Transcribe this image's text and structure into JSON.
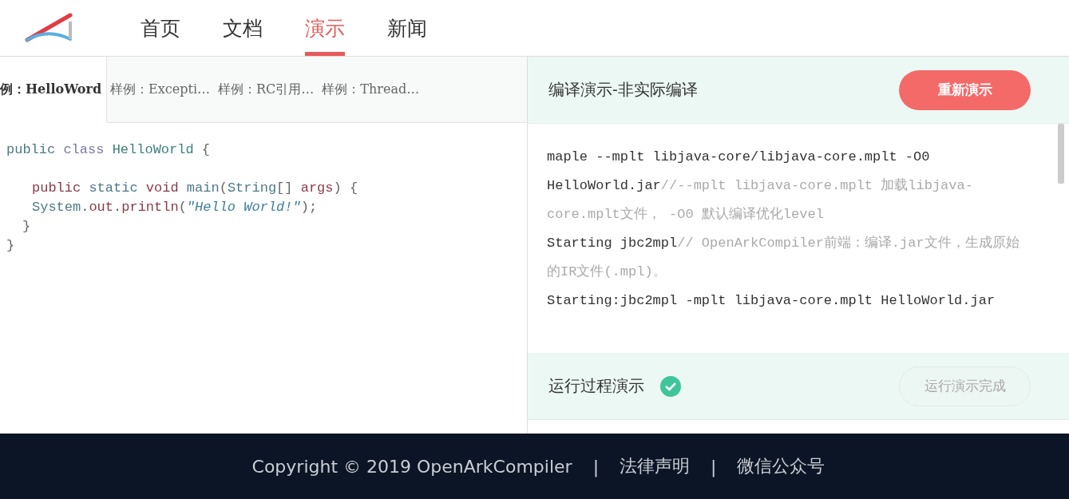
{
  "nav": [
    {
      "label": "首页",
      "selected": false
    },
    {
      "label": "文档",
      "selected": false
    },
    {
      "label": "演示",
      "selected": true
    },
    {
      "label": "新闻",
      "selected": false
    }
  ],
  "sample_tabs": [
    {
      "label": "例：HelloWord",
      "selected": true
    },
    {
      "label": "样例：Excepti…",
      "selected": false
    },
    {
      "label": "样例：RC引用…",
      "selected": false
    },
    {
      "label": "样例：Thread…",
      "selected": false
    }
  ],
  "code_lines": [
    {
      "kind": "class_open",
      "tokens": [
        {
          "kind": "keyword",
          "text": "public "
        },
        {
          "kind": "keyword2",
          "text": "class "
        },
        {
          "kind": "name",
          "text": "HelloWorld "
        },
        {
          "kind": "punct",
          "text": "{"
        }
      ]
    },
    {
      "kind": "method_open",
      "tokens": [
        {
          "kind": "red",
          "text": "public "
        },
        {
          "kind": "keyword",
          "text": "static "
        },
        {
          "kind": "red",
          "text": "void "
        },
        {
          "kind": "keyword",
          "text": "main"
        },
        {
          "kind": "punct",
          "text": "("
        },
        {
          "kind": "keyword",
          "text": "String"
        },
        {
          "kind": "punct",
          "text": "[] "
        },
        {
          "kind": "red",
          "text": "args"
        },
        {
          "kind": "punct",
          "text": ") {"
        }
      ]
    },
    {
      "kind": "statement",
      "tokens": [
        {
          "kind": "keyword",
          "text": "System"
        },
        {
          "kind": "punct",
          "text": "."
        },
        {
          "kind": "red",
          "text": "out"
        },
        {
          "kind": "punct",
          "text": "."
        },
        {
          "kind": "red",
          "text": "println"
        },
        {
          "kind": "punct",
          "text": "("
        },
        {
          "kind": "string",
          "text": "\"Hello World!\""
        },
        {
          "kind": "punct",
          "text": ");"
        }
      ]
    },
    {
      "kind": "method_close",
      "tokens": [
        {
          "kind": "punct",
          "text": "}"
        }
      ]
    },
    {
      "kind": "class_close",
      "tokens": [
        {
          "kind": "punct",
          "text": "}"
        }
      ]
    }
  ],
  "compile": {
    "title": "编译演示-非实际编译",
    "button": "重新演示",
    "log": [
      {
        "command": "maple --mplt libjava-core/libjava-core.mplt -O0 HelloWorld.jar",
        "comment": "//--mplt libjava-core.mplt 加载libjava-core.mplt文件， -O0 默认编译优化level"
      },
      {
        "command": "Starting jbc2mpl",
        "comment": "// OpenArkCompiler前端：编译.jar文件，生成原始的IR文件(.mpl)。"
      },
      {
        "command": "Starting:jbc2mpl -mplt libjava-core.mplt HelloWorld.jar"
      }
    ]
  },
  "run": {
    "title": "运行过程演示",
    "done": true,
    "button": "运行演示完成",
    "button_disabled": true
  },
  "footer": {
    "copyright": "Copyright © 2019 OpenArkCompiler",
    "separators": [
      "|",
      "|"
    ],
    "links": [
      "法律声明",
      "微信公众号"
    ]
  }
}
